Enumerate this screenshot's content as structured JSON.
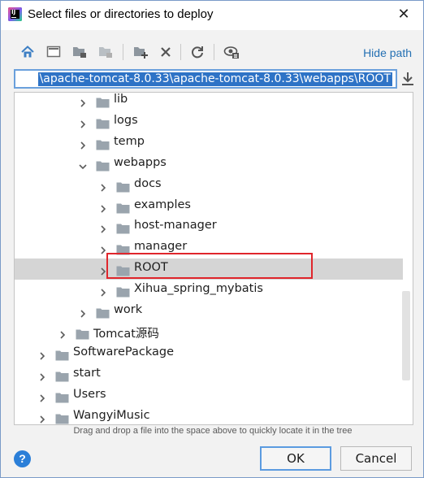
{
  "dialog": {
    "title": "Select files or directories to deploy",
    "close_glyph": "✕",
    "app_icon_text": "IJ"
  },
  "toolbar": {
    "buttons": [
      {
        "name": "home-icon"
      },
      {
        "name": "desktop-icon"
      },
      {
        "name": "project-folder-icon"
      },
      {
        "name": "module-folder-icon"
      },
      {
        "name": "new-folder-icon"
      },
      {
        "name": "delete-icon"
      },
      {
        "name": "refresh-icon"
      },
      {
        "name": "show-hidden-icon"
      }
    ],
    "hide_path_label": "Hide path"
  },
  "path": {
    "value": "\\apache-tomcat-8.0.33\\apache-tomcat-8.0.33\\webapps\\ROOT",
    "download_icon": "download-icon"
  },
  "tree": {
    "items": [
      {
        "label": "lib",
        "expanded": false,
        "selected": false
      },
      {
        "label": "logs",
        "expanded": false,
        "selected": false
      },
      {
        "label": "temp",
        "expanded": false,
        "selected": false
      },
      {
        "label": "webapps",
        "expanded": true,
        "selected": false
      },
      {
        "label": "docs",
        "expanded": false,
        "selected": false
      },
      {
        "label": "examples",
        "expanded": false,
        "selected": false
      },
      {
        "label": "host-manager",
        "expanded": false,
        "selected": false
      },
      {
        "label": "manager",
        "expanded": false,
        "selected": false
      },
      {
        "label": "ROOT",
        "expanded": false,
        "selected": true
      },
      {
        "label": "Xihua_spring_mybatis",
        "expanded": false,
        "selected": false
      },
      {
        "label": "work",
        "expanded": false,
        "selected": false
      },
      {
        "label": "Tomcat源码",
        "expanded": false,
        "selected": false
      },
      {
        "label": "SoftwarePackage",
        "expanded": false,
        "selected": false
      },
      {
        "label": "start",
        "expanded": false,
        "selected": false
      },
      {
        "label": "Users",
        "expanded": false,
        "selected": false
      },
      {
        "label": "WangyiMusic",
        "expanded": false,
        "selected": false
      }
    ]
  },
  "hint": "Drag and drop a file into the space above to quickly locate it in the tree",
  "footer": {
    "help_glyph": "?",
    "ok_label": "OK",
    "cancel_label": "Cancel"
  },
  "colors": {
    "accent": "#2470b3",
    "selection": "#2e73c6",
    "highlight_border": "#e0262c",
    "folder": "#9aa4ad"
  }
}
